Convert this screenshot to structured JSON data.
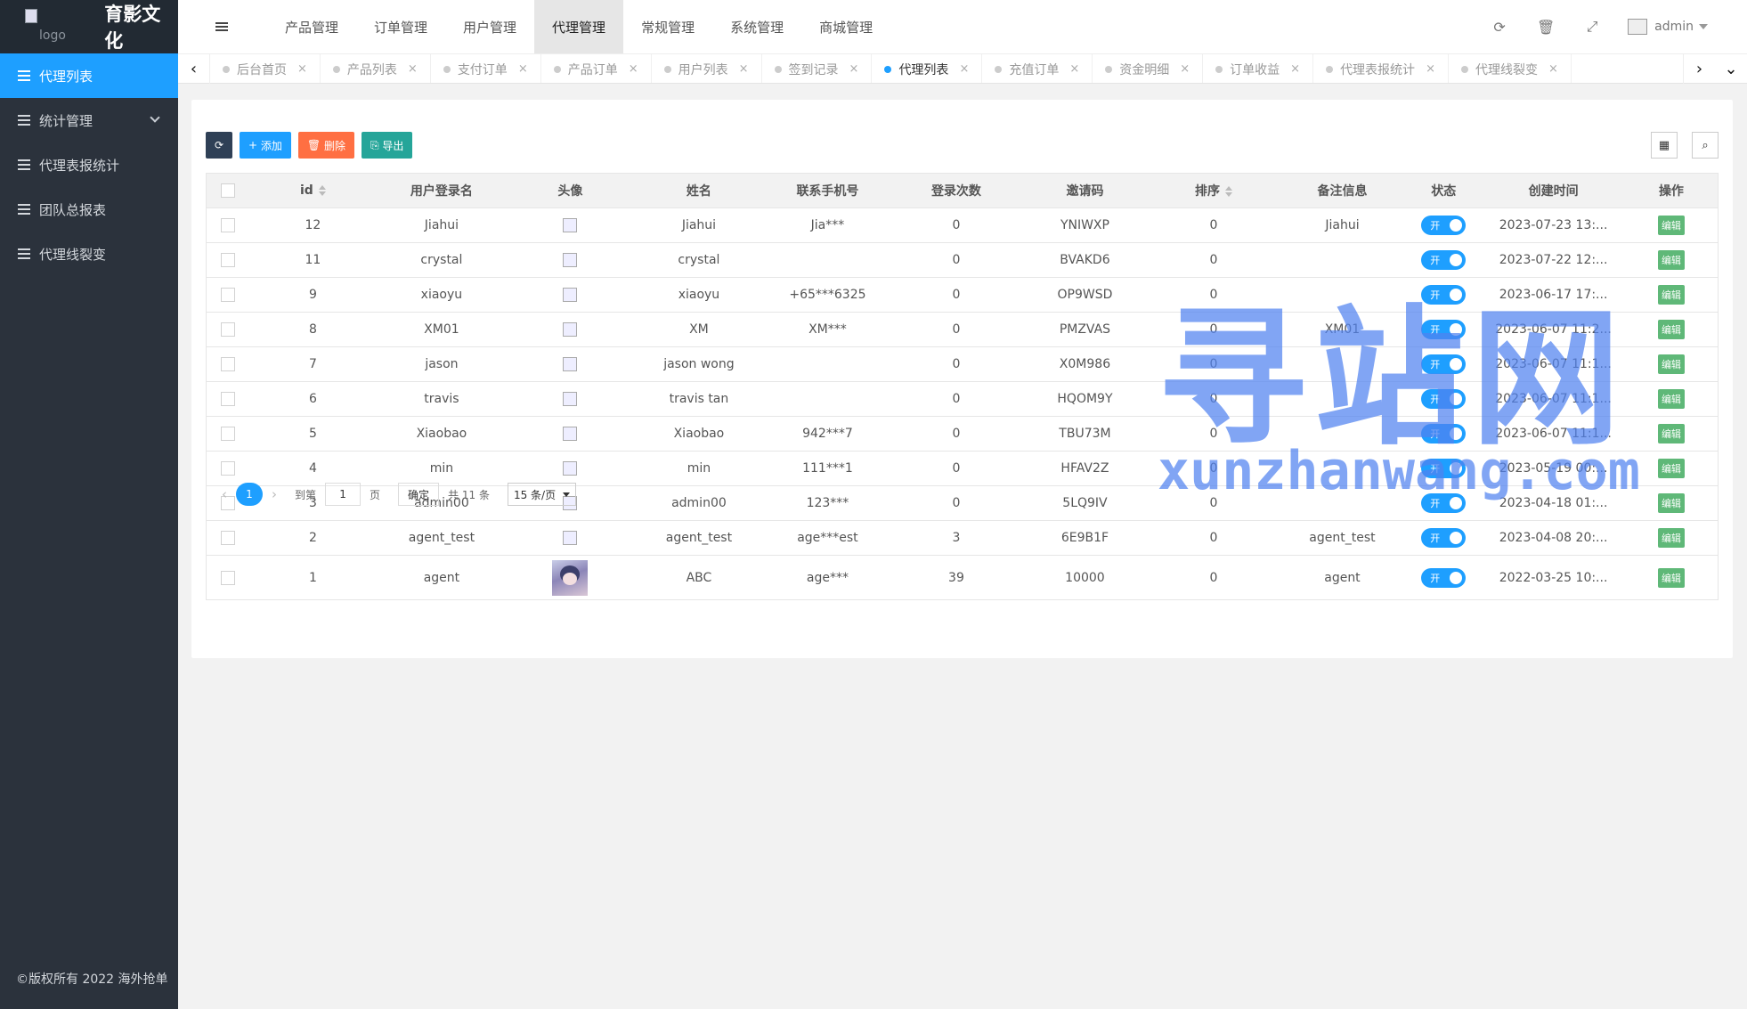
{
  "brand": {
    "logo_alt": "logo",
    "name": "育影文化"
  },
  "sidebar": {
    "items": [
      {
        "label": "代理列表",
        "active": true
      },
      {
        "label": "统计管理",
        "expandable": true
      },
      {
        "label": "代理表报统计"
      },
      {
        "label": "团队总报表"
      },
      {
        "label": "代理线裂变"
      }
    ],
    "footer": "©版权所有 2022 海外抢单"
  },
  "topnav": {
    "items": [
      "产品管理",
      "订单管理",
      "用户管理",
      "代理管理",
      "常规管理",
      "系统管理",
      "商城管理"
    ],
    "active_index": 3
  },
  "user": {
    "name": "admin"
  },
  "tabs": {
    "items": [
      "后台首页",
      "产品列表",
      "支付订单",
      "产品订单",
      "用户列表",
      "签到记录",
      "代理列表",
      "充值订单",
      "资金明细",
      "订单收益",
      "代理表报统计",
      "代理线裂变"
    ],
    "active_index": 6
  },
  "toolbar": {
    "refresh": "",
    "add": "添加",
    "delete": "删除",
    "export": "导出"
  },
  "table": {
    "columns": [
      "id",
      "用户登录名",
      "头像",
      "姓名",
      "联系手机号",
      "登录次数",
      "邀请码",
      "排序",
      "备注信息",
      "状态",
      "创建时间",
      "操作"
    ],
    "rows": [
      {
        "id": "12",
        "login": "Jiahui",
        "name": "Jiahui",
        "phone": "Jia***",
        "logins": "0",
        "invite": "YNIWXP",
        "sort": "0",
        "remark": "Jiahui",
        "status": "开",
        "created": "2023-07-23 13:...",
        "action": "编辑"
      },
      {
        "id": "11",
        "login": "crystal",
        "name": "crystal",
        "phone": "",
        "logins": "0",
        "invite": "BVAKD6",
        "sort": "0",
        "remark": "",
        "status": "开",
        "created": "2023-07-22 12:...",
        "action": "编辑"
      },
      {
        "id": "9",
        "login": "xiaoyu",
        "name": "xiaoyu",
        "phone": "+65***6325",
        "logins": "0",
        "invite": "OP9WSD",
        "sort": "0",
        "remark": "",
        "status": "开",
        "created": "2023-06-17 17:...",
        "action": "编辑"
      },
      {
        "id": "8",
        "login": "XM01",
        "name": "XM",
        "phone": "XM***",
        "logins": "0",
        "invite": "PMZVAS",
        "sort": "0",
        "remark": "XM01",
        "status": "开",
        "created": "2023-06-07 11:2...",
        "action": "编辑"
      },
      {
        "id": "7",
        "login": "jason",
        "name": "jason wong",
        "phone": "",
        "logins": "0",
        "invite": "X0M986",
        "sort": "0",
        "remark": "",
        "status": "开",
        "created": "2023-06-07 11:1...",
        "action": "编辑"
      },
      {
        "id": "6",
        "login": "travis",
        "name": "travis tan",
        "phone": "",
        "logins": "0",
        "invite": "HQOM9Y",
        "sort": "0",
        "remark": "",
        "status": "开",
        "created": "2023-06-07 11:1...",
        "action": "编辑"
      },
      {
        "id": "5",
        "login": "Xiaobao",
        "name": "Xiaobao",
        "phone": "942***7",
        "logins": "0",
        "invite": "TBU73M",
        "sort": "0",
        "remark": "",
        "status": "开",
        "created": "2023-06-07 11:1...",
        "action": "编辑"
      },
      {
        "id": "4",
        "login": "min",
        "name": "min",
        "phone": "111***1",
        "logins": "0",
        "invite": "HFAV2Z",
        "sort": "0",
        "remark": "",
        "status": "开",
        "created": "2023-05-19 00:...",
        "action": "编辑"
      },
      {
        "id": "3",
        "login": "admin00",
        "name": "admin00",
        "phone": "123***",
        "logins": "0",
        "invite": "5LQ9IV",
        "sort": "0",
        "remark": "",
        "status": "开",
        "created": "2023-04-18 01:...",
        "action": "编辑"
      },
      {
        "id": "2",
        "login": "agent_test",
        "name": "agent_test",
        "phone": "age***est",
        "logins": "3",
        "invite": "6E9B1F",
        "sort": "0",
        "remark": "agent_test",
        "status": "开",
        "created": "2023-04-08 20:...",
        "action": "编辑"
      },
      {
        "id": "1",
        "login": "agent",
        "name": "ABC",
        "phone": "age***",
        "logins": "39",
        "invite": "10000",
        "sort": "0",
        "remark": "agent",
        "status": "开",
        "created": "2022-03-25 10:...",
        "action": "编辑",
        "has_avatar": true
      }
    ]
  },
  "pager": {
    "current": "1",
    "goto_label": "到第",
    "page_input": "1",
    "page_unit": "页",
    "confirm": "确定",
    "total": "共 11 条",
    "page_size": "15 条/页"
  },
  "watermark": {
    "cn": "寻站网",
    "en": "xunzhanwang.com"
  }
}
